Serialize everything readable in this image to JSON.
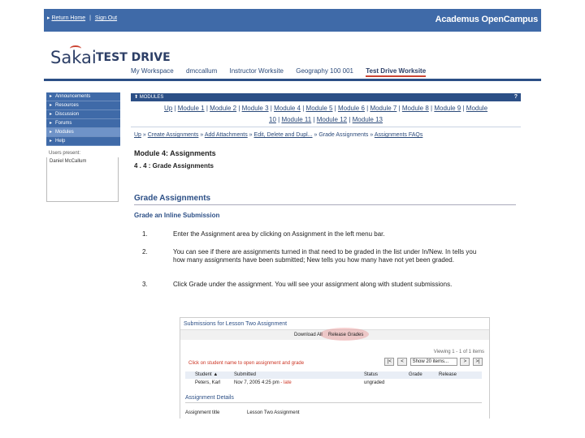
{
  "topbar": {
    "links": [
      "Return Home",
      "Sign Out"
    ],
    "brand": "Academus OpenCampus"
  },
  "site": {
    "logo": "Sakai",
    "title": "TEST DRIVE",
    "tabs": [
      "My Workspace",
      "dmccallum",
      "Instructor Worksite",
      "Geography 100 001",
      "Test Drive Worksite"
    ]
  },
  "nav": {
    "items": [
      "Announcements",
      "Resources",
      "Discussion",
      "Forums",
      "Modules",
      "Help"
    ],
    "presence_label": "Users present:",
    "presence_user": "Daniel McCallum"
  },
  "main": {
    "bar_title": "MODULES",
    "help": "?",
    "module_links_row1": [
      "Up",
      "Module 1",
      "Module 2",
      "Module 3",
      "Module 4",
      "Module 5",
      "Module 6",
      "Module 7",
      "Module 8",
      "Module 9",
      "Module"
    ],
    "module_links_row2": [
      "10",
      "Module 11",
      "Module 12",
      "Module 13"
    ],
    "crumbs": [
      "Up",
      "Create Assignments",
      "Add Attachments",
      "Edit, Delete and Dupl...",
      "Grade Assignments",
      "Assignments FAQs"
    ],
    "module_title": "Module 4: Assignments",
    "section_title": "4 . 4 : Grade Assignments",
    "big_title": "Grade Assignments",
    "subtitle": "Grade an Inline Submission",
    "steps": [
      {
        "num": "1.",
        "text": "Enter the Assignment area by clicking on Assignment in the left menu bar."
      },
      {
        "num": "2.",
        "text": "You can see if there are assignments turned in that need to be graded in the list under In/New. In tells you how many assignments have been submitted; New tells you how many have not yet been graded."
      },
      {
        "num": "3.",
        "text": "Click Grade under the assignment. You will see your assignment along with student submissions."
      }
    ]
  },
  "shot": {
    "title": "Submissions for Lesson Two Assignment",
    "download": "Download All",
    "release": "Release Grades",
    "viewing": "Viewing 1 - 1 of 1 items",
    "message": "Click on student name to open assignment and grade",
    "page_size": "Show 20 items...",
    "pager": [
      "|<",
      "<",
      ">",
      ">|"
    ],
    "headers": [
      "Student ▲",
      "Submitted",
      "Status",
      "Grade",
      "Release"
    ],
    "row": {
      "student": "Peters, Karl",
      "submitted": "Nov 7, 2005 4:25 pm",
      "late": "- late",
      "status": "ungraded"
    },
    "details_title": "Assignment Details",
    "detail_label": "Assignment title",
    "detail_value": "Lesson Two Assignment"
  }
}
